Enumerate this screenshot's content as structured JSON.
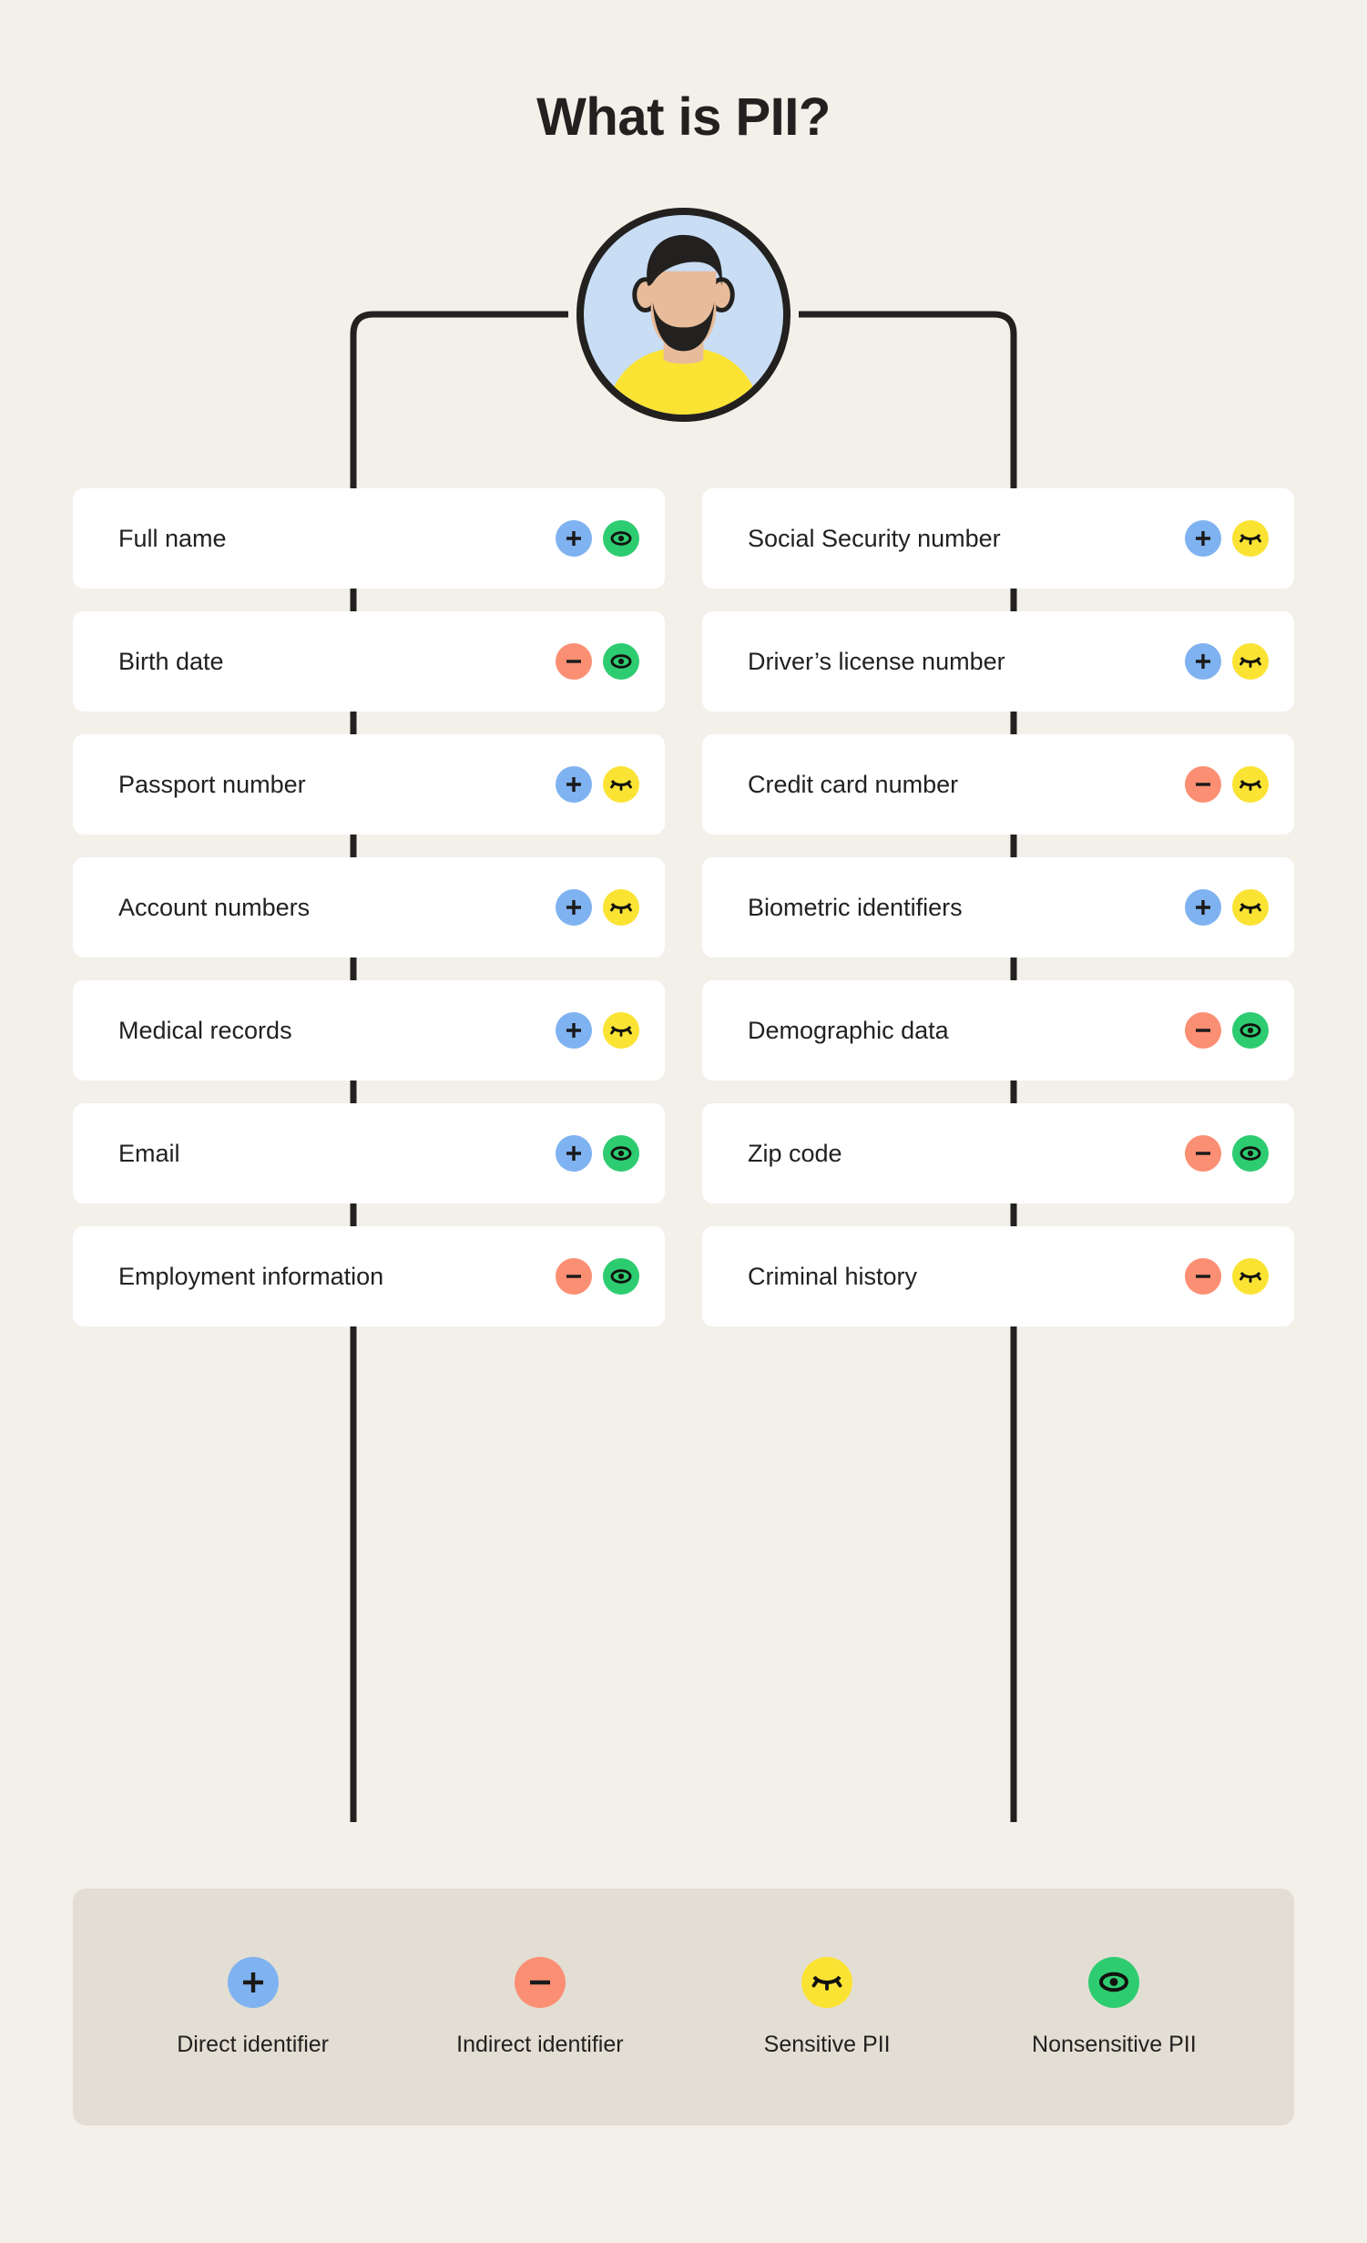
{
  "title": "What is PII?",
  "avatar": {
    "name": "person-avatar",
    "bg_color": "#C9DDF5",
    "shirt_color": "#FBE334",
    "hair_color": "#22211F",
    "skin_color": "#E8BC9A"
  },
  "colors": {
    "page_background": "#F3F0EA",
    "card_background": "#FFFFFF",
    "legend_background": "#E3DED4",
    "ink": "#22211F",
    "direct": "#7FB2F0",
    "indirect": "#FB8F73",
    "sensitive": "#FBE334",
    "nonsensitive": "#2ECC71"
  },
  "columns": [
    {
      "side": "left",
      "items": [
        {
          "label": "Full name",
          "identifier": "direct",
          "sensitivity": "nonsensitive"
        },
        {
          "label": "Birth date",
          "identifier": "indirect",
          "sensitivity": "nonsensitive"
        },
        {
          "label": "Passport number",
          "identifier": "direct",
          "sensitivity": "sensitive"
        },
        {
          "label": "Account numbers",
          "identifier": "direct",
          "sensitivity": "sensitive"
        },
        {
          "label": "Medical records",
          "identifier": "direct",
          "sensitivity": "sensitive"
        },
        {
          "label": "Email",
          "identifier": "direct",
          "sensitivity": "nonsensitive"
        },
        {
          "label": "Employment information",
          "identifier": "indirect",
          "sensitivity": "nonsensitive"
        }
      ]
    },
    {
      "side": "right",
      "items": [
        {
          "label": "Social Security number",
          "identifier": "direct",
          "sensitivity": "sensitive"
        },
        {
          "label": "Driver’s license number",
          "identifier": "direct",
          "sensitivity": "sensitive"
        },
        {
          "label": "Credit card number",
          "identifier": "indirect",
          "sensitivity": "sensitive"
        },
        {
          "label": "Biometric identifiers",
          "identifier": "direct",
          "sensitivity": "sensitive"
        },
        {
          "label": "Demographic data",
          "identifier": "indirect",
          "sensitivity": "nonsensitive"
        },
        {
          "label": "Zip code",
          "identifier": "indirect",
          "sensitivity": "nonsensitive"
        },
        {
          "label": "Criminal history",
          "identifier": "indirect",
          "sensitivity": "sensitive"
        }
      ]
    }
  ],
  "legend": [
    {
      "icon": "plus-icon",
      "color_key": "direct",
      "color": "#7FB2F0",
      "label": "Direct identifier"
    },
    {
      "icon": "minus-icon",
      "color_key": "indirect",
      "color": "#FB8F73",
      "label": "Indirect identifier"
    },
    {
      "icon": "eye-closed-icon",
      "color_key": "sensitive",
      "color": "#FBE334",
      "label": "Sensitive PII"
    },
    {
      "icon": "eye-open-icon",
      "color_key": "nonsensitive",
      "color": "#2ECC71",
      "label": "Nonsensitive PII"
    }
  ]
}
